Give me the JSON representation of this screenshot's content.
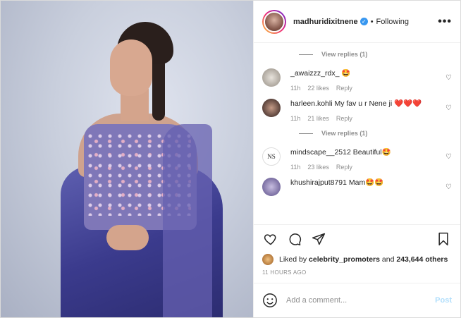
{
  "header": {
    "username": "madhuridixitnene",
    "dot": "•",
    "follow_state": "Following",
    "more": "•••"
  },
  "comments": [
    {
      "type": "replies",
      "text": "View replies (1)"
    },
    {
      "type": "comment",
      "username": "_awaizzz_rdx_",
      "text": "🤩",
      "time": "11h",
      "likes": "22 likes",
      "reply": "Reply",
      "avatar_color": "#c9c4bd"
    },
    {
      "type": "comment",
      "username": "harleen.kohli",
      "text": "My fav u r Nene ji ❤️❤️❤️",
      "time": "11h",
      "likes": "21 likes",
      "reply": "Reply",
      "avatar_color": "#6b5148"
    },
    {
      "type": "replies",
      "text": "View replies (1)"
    },
    {
      "type": "comment",
      "username": "mindscape__2512",
      "text": "Beautiful🤩",
      "time": "11h",
      "likes": "23 likes",
      "reply": "Reply",
      "avatar_color": "#ffffff",
      "avatar_text": "NS"
    },
    {
      "type": "comment",
      "username": "khushirajput8791",
      "text": "Mam🤩🤩",
      "time": "",
      "likes": "",
      "reply": "",
      "avatar_color": "#8b7fb3"
    }
  ],
  "likes": {
    "prefix": "Liked by",
    "liker": "celebrity_promoters",
    "and": "and",
    "count": "243,644 others"
  },
  "timestamp": "11 HOURS AGO",
  "add_comment": {
    "placeholder": "Add a comment...",
    "post_label": "Post"
  },
  "colors": {
    "accent": "#3897f0",
    "post_disabled": "#b2dffc",
    "muted": "#8e8e8e"
  }
}
